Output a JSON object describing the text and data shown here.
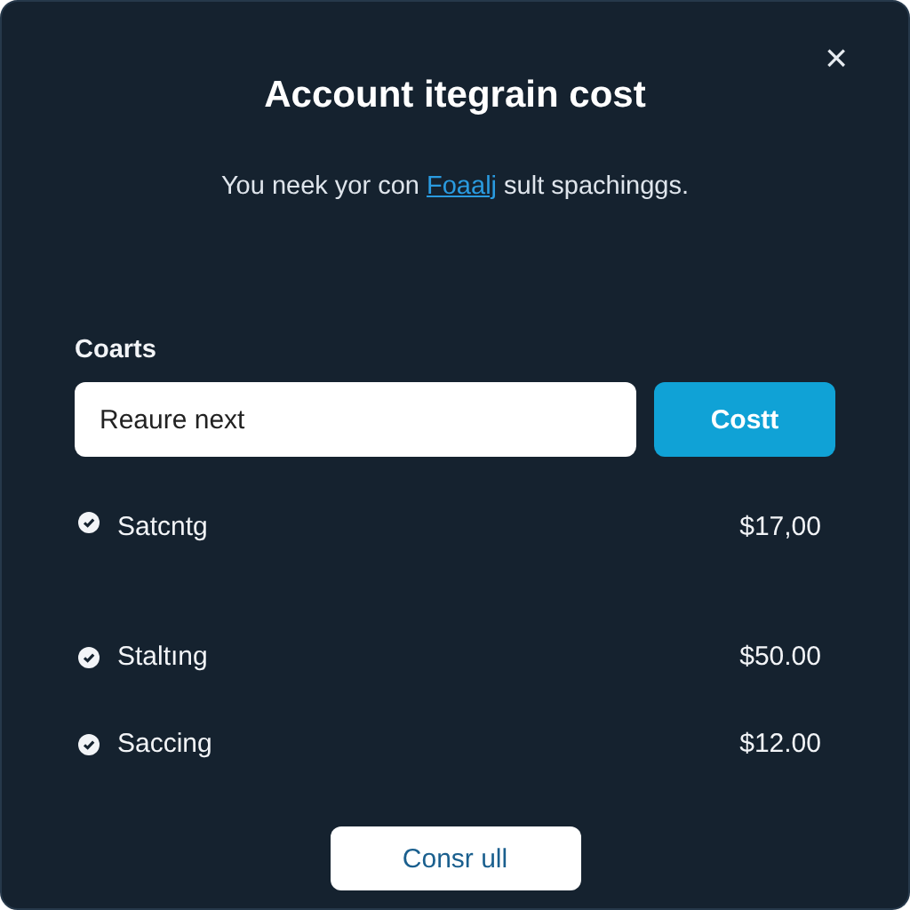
{
  "dialog": {
    "title": "Account itegrain cost",
    "close": "×",
    "subtitle": {
      "before": "You neek yor con ",
      "link": "Foaalj",
      "after": " sult spachinggs."
    }
  },
  "field": {
    "label": "Coarts",
    "value": "Reaure next",
    "button": "Costt"
  },
  "items": [
    {
      "name": "Satcntg",
      "price": "$17,00"
    },
    {
      "name": "Staltıng",
      "price": "$50.00"
    },
    {
      "name": "Saccing",
      "price": "$12.00"
    }
  ],
  "footer_button": "Consr ull"
}
